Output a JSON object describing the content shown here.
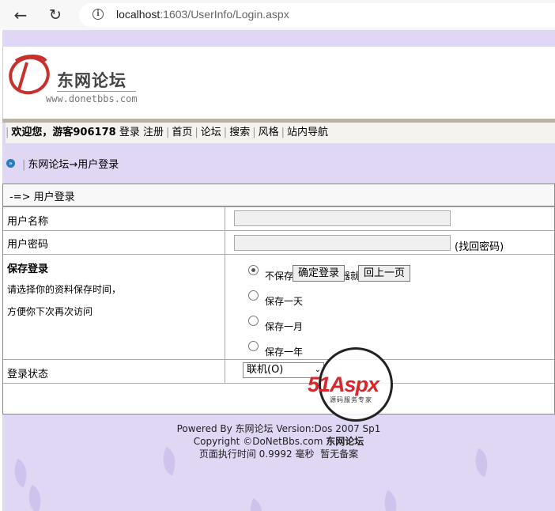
{
  "browser": {
    "url_host": "localhost",
    "url_rest": ":1603/UserInfo/Login.aspx"
  },
  "header": {
    "logo_title": "东网论坛",
    "logo_url": "www.donetbbs.com"
  },
  "menubar": {
    "welcome": "欢迎您，游客906178",
    "links": [
      "登录",
      "注册",
      "首页",
      "论坛",
      "搜索",
      "风格",
      "站内导航"
    ]
  },
  "breadcrumb": {
    "text": "东网论坛→用户登录"
  },
  "form": {
    "title": "-=> 用户登录",
    "username_label": "用户名称",
    "password_label": "用户密码",
    "find_password": "(找回密码)",
    "save_title": "保存登录",
    "save_desc1": "请选择你的资料保存时间，",
    "save_desc2": "方便你下次再次访问",
    "save_options": [
      "不保存，关闭浏览器就",
      "保存一天",
      "保存一月",
      "保存一年"
    ],
    "save_selected": 0,
    "status_label": "登录状态",
    "status_value": "联机(O)",
    "submit": "确定登录",
    "back": "回上一页"
  },
  "footer": {
    "line1_prefix": "Powered By ",
    "line1_name": "东网论坛",
    "line1_version": " Version:Dos 2007 Sp1",
    "line2_prefix": "Copyright ©DoNetBbs.com ",
    "line2_name": "东网论坛",
    "line3": "页面执行时间 0.9992 毫秒",
    "line3_icp": "暂无备案"
  },
  "watermark": {
    "brand_51": "51",
    "brand_aspx": "Aspx",
    "sub": "源码服务专家"
  },
  "colors": {
    "page_bg": "#e0d7f4",
    "leaf": "#cbbdea",
    "watermark_red": "#d8262c",
    "watermark_green": "#2e8b3a"
  }
}
